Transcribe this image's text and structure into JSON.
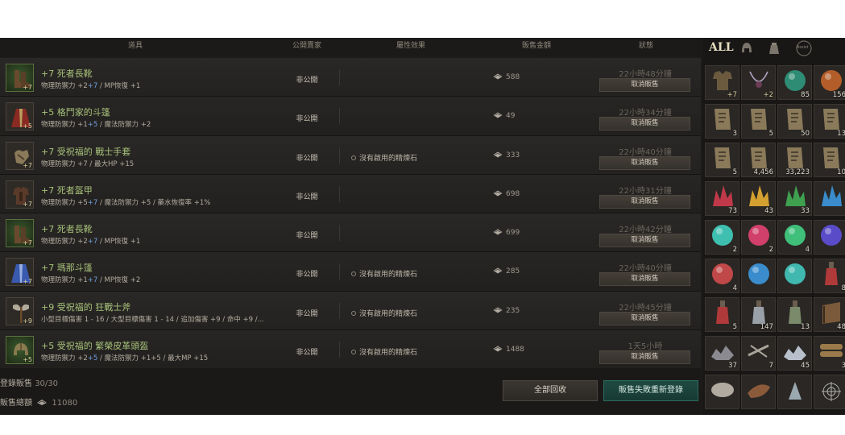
{
  "header": {
    "col_item": "道具",
    "col_seller": "公開賣家",
    "col_effect": "屬性效果",
    "col_price": "販售金額",
    "col_status": "狀態"
  },
  "rows": [
    {
      "name": "+7 死者長靴",
      "enh": "+7",
      "stats": [
        "物理防禦力 +2",
        "+7",
        " / MP恢復 +1"
      ],
      "seller": "非公開",
      "effect": "",
      "price": "588",
      "time": "22小時48分鐘",
      "cancel": "取消販售",
      "icon": "boots-icon"
    },
    {
      "name": "+5 格鬥家的斗篷",
      "enh": "+5",
      "stats": [
        "物理防禦力 +1",
        "+5",
        " / 魔法防禦力 +2"
      ],
      "seller": "非公開",
      "effect": "",
      "price": "49",
      "time": "22小時34分鐘",
      "cancel": "取消販售",
      "icon": "cloak-icon"
    },
    {
      "name": "+7 受祝福的 戰士手套",
      "enh": "+7",
      "stats": [
        "物理防禦力 +7 / 最大HP +15",
        "",
        ""
      ],
      "seller": "非公開",
      "effect": "沒有啟用的精煉石",
      "price": "333",
      "time": "22小時40分鐘",
      "cancel": "取消販售",
      "icon": "gloves-icon"
    },
    {
      "name": "+7 死者盔甲",
      "enh": "+7",
      "stats": [
        "物理防禦力 +5",
        "+7",
        " / 魔法防禦力 +5 / 藥水恢復率 +1%"
      ],
      "seller": "非公開",
      "effect": "",
      "price": "698",
      "time": "22小時31分鐘",
      "cancel": "取消販售",
      "icon": "armor-icon"
    },
    {
      "name": "+7 死者長靴",
      "enh": "+7",
      "stats": [
        "物理防禦力 +2",
        "+7",
        " / MP恢復 +1"
      ],
      "seller": "非公開",
      "effect": "",
      "price": "699",
      "time": "22小時42分鐘",
      "cancel": "取消販售",
      "icon": "boots-icon"
    },
    {
      "name": "+7 瑪那斗篷",
      "enh": "+7",
      "stats": [
        "物理防禦力 +1",
        "+7",
        " / MP恢復 +2"
      ],
      "seller": "非公開",
      "effect": "沒有啟用的精煉石",
      "price": "285",
      "time": "22小時40分鐘",
      "cancel": "取消販售",
      "icon": "mana-cloak-icon"
    },
    {
      "name": "+9 受祝福的 狂戰士斧",
      "enh": "+9",
      "stats": [
        "小型目標傷害 1 - 16 / 大型目標傷害 1 - 14 / 追加傷害 +9 / 命中 +9 /...",
        "",
        ""
      ],
      "seller": "非公開",
      "effect": "沒有啟用的精煉石",
      "price": "235",
      "time": "22小時45分鐘",
      "cancel": "取消販售",
      "icon": "axe-icon"
    },
    {
      "name": "+5 受祝福的 繁榮皮革頭盔",
      "enh": "+5",
      "stats": [
        "物理防禦力 +2",
        "+5",
        " / 魔法防禦力 +1+5 / 最大MP +15"
      ],
      "seller": "非公開",
      "effect": "沒有啟用的精煉石",
      "price": "1488",
      "time": "1天5小時",
      "cancel": "取消販售",
      "icon": "helmet-icon"
    }
  ],
  "footer": {
    "listed_label": "登錄販售",
    "listed_value": "30/30",
    "total_label": "販售總額",
    "total_value": "11080",
    "reclaim_all": "全部回收",
    "relist_failed": "販售失敗重新登錄"
  },
  "tabs": {
    "all": "ALL",
    "extra": "Assist"
  },
  "inventory": [
    {
      "icon": "armor-icon",
      "count": "+7",
      "color": "#6b5a3e"
    },
    {
      "icon": "necklace-icon",
      "count": "+2",
      "color": "#6a3d55"
    },
    {
      "icon": "orb-icon",
      "count": "85",
      "color": "#2f8c74"
    },
    {
      "icon": "orb-icon",
      "count": "156",
      "color": "#b35e2a"
    },
    {
      "icon": "scroll-icon",
      "count": "3",
      "color": "#8a7a5a"
    },
    {
      "icon": "scroll-icon",
      "count": "5",
      "color": "#8a7a5a"
    },
    {
      "icon": "scroll-icon",
      "count": "50",
      "color": "#8a7a5a"
    },
    {
      "icon": "scroll-icon",
      "count": "13",
      "color": "#8a7a5a"
    },
    {
      "icon": "scroll-icon",
      "count": "5",
      "color": "#8a7a5a"
    },
    {
      "icon": "scroll-icon",
      "count": "4,456",
      "color": "#8a7a5a"
    },
    {
      "icon": "scroll-icon",
      "count": "33,223",
      "color": "#8a7a5a"
    },
    {
      "icon": "scroll-icon",
      "count": "10",
      "color": "#8a7a5a"
    },
    {
      "icon": "crystal-icon",
      "count": "73",
      "color": "#c0394a"
    },
    {
      "icon": "crystal-icon",
      "count": "43",
      "color": "#d4a030"
    },
    {
      "icon": "crystal-icon",
      "count": "33",
      "color": "#3fa050"
    },
    {
      "icon": "crystal-icon",
      "count": "",
      "color": "#3a8ccc"
    },
    {
      "icon": "gem-icon",
      "count": "2",
      "color": "#3fbfb0"
    },
    {
      "icon": "gem-icon",
      "count": "2",
      "color": "#d0406a"
    },
    {
      "icon": "gem-icon",
      "count": "4",
      "color": "#3fbf7a"
    },
    {
      "icon": "gem-icon",
      "count": "",
      "color": "#5a4cc8"
    },
    {
      "icon": "gem-icon",
      "count": "4",
      "color": "#c04848"
    },
    {
      "icon": "gem-icon",
      "count": "",
      "color": "#3a8ccc"
    },
    {
      "icon": "gem-icon",
      "count": "",
      "color": "#40b8b0"
    },
    {
      "icon": "potion-icon",
      "count": "8",
      "color": "#b03a3a"
    },
    {
      "icon": "potion-icon",
      "count": "5",
      "color": "#b03a3a"
    },
    {
      "icon": "potion-icon",
      "count": "147",
      "color": "#9aa0a8"
    },
    {
      "icon": "potion-icon",
      "count": "13",
      "color": "#7a8a6a"
    },
    {
      "icon": "book-icon",
      "count": "48",
      "color": "#7a5a3a"
    },
    {
      "icon": "ore-icon",
      "count": "37",
      "color": "#8a8a90"
    },
    {
      "icon": "bone-icon",
      "count": "7",
      "color": "#a8a49a"
    },
    {
      "icon": "ore-icon",
      "count": "45",
      "color": "#b8c0cc"
    },
    {
      "icon": "log-icon",
      "count": "3",
      "color": "#9a7a4a"
    },
    {
      "icon": "cloth-icon",
      "count": "",
      "color": "#b0aaa0"
    },
    {
      "icon": "hide-icon",
      "count": "",
      "color": "#8a5a3a"
    },
    {
      "icon": "shard-icon",
      "count": "",
      "color": "#9aa8b0"
    },
    {
      "icon": "web-icon",
      "count": "",
      "color": "#b0b0b0"
    }
  ]
}
